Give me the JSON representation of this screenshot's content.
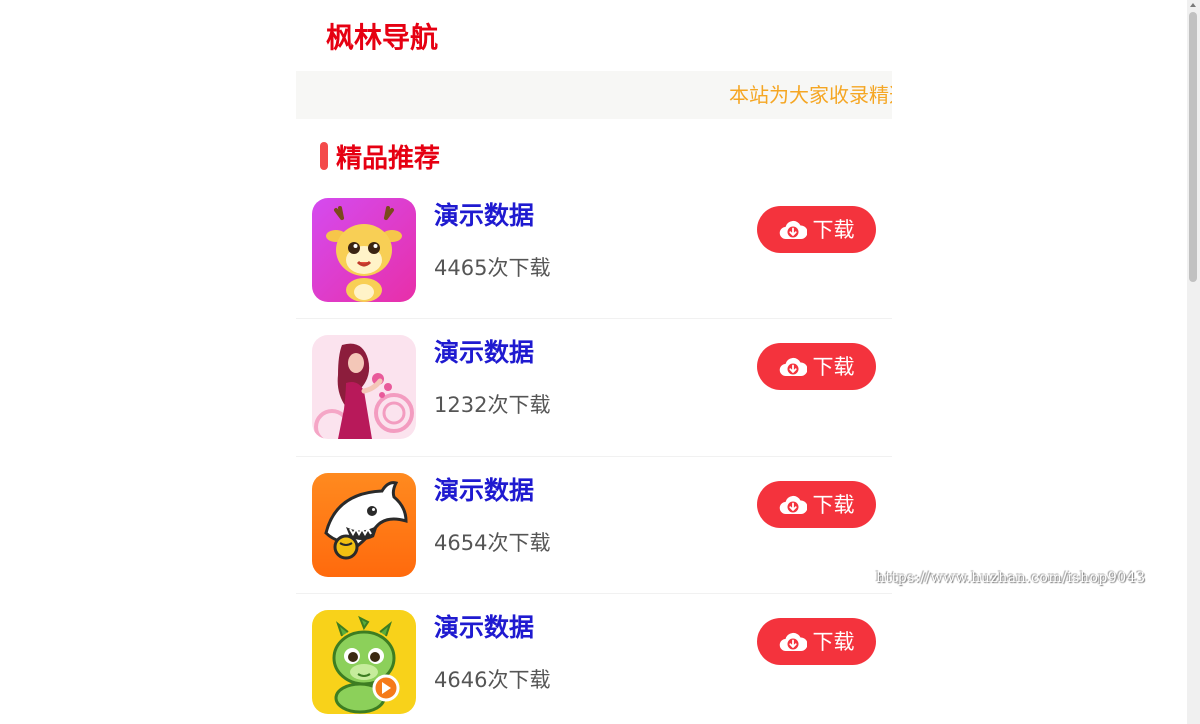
{
  "site": {
    "title": "枫林导航",
    "notice": "本站为大家收录精选"
  },
  "section": {
    "title": "精品推荐"
  },
  "apps": [
    {
      "name": "演示数据",
      "downloads": "4465次下载",
      "button_label": "下载",
      "icon": "deer-cartoon-icon"
    },
    {
      "name": "演示数据",
      "downloads": "1232次下载",
      "button_label": "下载",
      "icon": "woman-illustration-icon"
    },
    {
      "name": "演示数据",
      "downloads": "4654次下载",
      "button_label": "下载",
      "icon": "shark-cartoon-icon"
    },
    {
      "name": "演示数据",
      "downloads": "4646次下载",
      "button_label": "下载",
      "icon": "dragon-cartoon-icon"
    }
  ],
  "watermark": "https://www.huzhan.com/ishop9043",
  "colors": {
    "title_red": "#e60012",
    "notice_orange": "#f5a623",
    "app_name_blue": "#1f1ad0",
    "button_red": "#f4333d"
  }
}
